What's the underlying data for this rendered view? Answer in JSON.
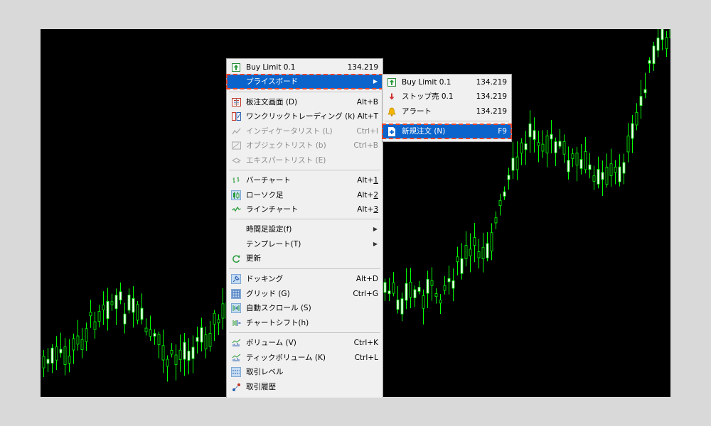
{
  "context_menu": {
    "items": [
      {
        "label": "Buy Limit 0.1",
        "shortcut": "134.219",
        "icon": "buy-limit-icon"
      },
      {
        "label": "プライスボード",
        "submenu": true,
        "highlighted": true
      },
      {
        "label": "板注文画面 (D)",
        "shortcut": "Alt+B",
        "icon": "order-book-icon"
      },
      {
        "label": "ワンクリックトレーディング (k)",
        "shortcut": "Alt+T",
        "icon": "one-click-icon"
      },
      {
        "label": "インディケータリスト (L)",
        "shortcut": "Ctrl+I",
        "icon": "indicator-list-icon",
        "disabled": true
      },
      {
        "label": "オブジェクトリスト (b)",
        "shortcut": "Ctrl+B",
        "icon": "object-list-icon",
        "disabled": true
      },
      {
        "label": "エキスパートリスト (E)",
        "shortcut": "",
        "icon": "expert-list-icon",
        "disabled": true
      },
      {
        "label": "バーチャート",
        "shortcut_main": "Alt+",
        "shortcut_key": "1",
        "icon": "bar-chart-icon"
      },
      {
        "label": "ローソク足",
        "shortcut_main": "Alt+",
        "shortcut_key": "2",
        "icon": "candlestick-icon",
        "checked": true
      },
      {
        "label": "ラインチャート",
        "shortcut_main": "Alt+",
        "shortcut_key": "3",
        "icon": "line-chart-icon"
      },
      {
        "label": "時間足設定(f)",
        "submenu": true
      },
      {
        "label": "テンプレート(T)",
        "submenu": true
      },
      {
        "label": "更新",
        "icon": "refresh-icon"
      },
      {
        "label": "ドッキング",
        "shortcut": "Alt+D",
        "icon": "docking-icon",
        "checked": true
      },
      {
        "label": "グリッド (G)",
        "shortcut": "Ctrl+G",
        "icon": "grid-icon",
        "checked": true
      },
      {
        "label": "自動スクロール (S)",
        "icon": "auto-scroll-icon",
        "checked": true
      },
      {
        "label": "チャートシフト(h)",
        "icon": "chart-shift-icon"
      },
      {
        "label": "ボリューム (V)",
        "shortcut": "Ctrl+K",
        "icon": "volume-icon"
      },
      {
        "label": "ティックボリューム (K)",
        "shortcut": "Ctrl+L",
        "icon": "tick-volume-icon"
      },
      {
        "label": "取引レベル",
        "icon": "trade-levels-icon",
        "checked": true
      },
      {
        "label": "取引履歴",
        "icon": "trade-history-icon"
      }
    ]
  },
  "submenu": {
    "items": [
      {
        "label": "Buy Limit 0.1",
        "shortcut": "134.219",
        "icon": "buy-limit-icon"
      },
      {
        "label": "ストップ売 0.1",
        "shortcut": "134.219",
        "icon": "sell-stop-icon"
      },
      {
        "label": "アラート",
        "shortcut": "134.219",
        "icon": "alert-bell-icon"
      },
      {
        "label": "新規注文 (N)",
        "shortcut": "F9",
        "icon": "new-order-icon",
        "highlighted": true
      }
    ]
  },
  "chart": {
    "background": "#000000",
    "bull_color": "#00ff00",
    "body_color": "#ffffff",
    "wick_color": "#00ff00"
  },
  "colors": {
    "highlight": "#0a64cc",
    "annotation_box": "#e8452a",
    "menu_bg": "#f0f0f0"
  }
}
